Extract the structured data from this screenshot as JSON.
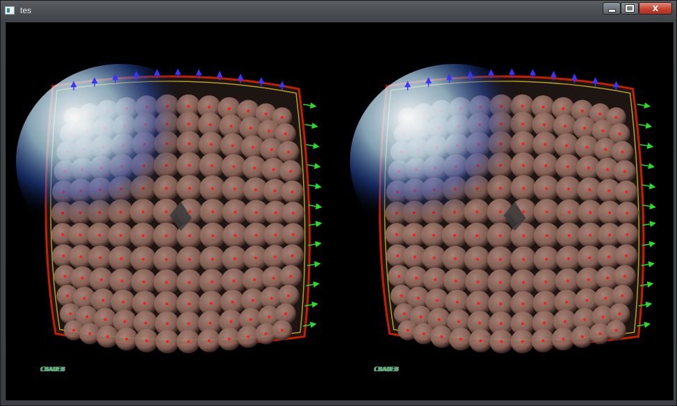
{
  "window": {
    "title": "tes",
    "controls": {
      "minimize": "",
      "maximize": "",
      "close": "X"
    }
  },
  "viewport": {
    "eyes": [
      "left",
      "right"
    ],
    "stats_text": "CBAUEB",
    "colors": {
      "frame_outer": "#c81e00",
      "frame_inner": "#e2c020",
      "ball": "#8a6458",
      "dot": "#ff1a1a",
      "up_arrow": "#3a34ff",
      "right_arrow": "#22e022"
    }
  }
}
